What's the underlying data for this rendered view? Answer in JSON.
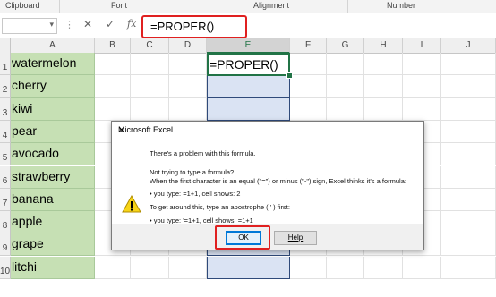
{
  "ribbon": {
    "groups": [
      "Clipboard",
      "Font",
      "Alignment",
      "Number"
    ]
  },
  "formula_bar": {
    "name_box_value": "",
    "cancel_icon": "close-icon",
    "enter_icon": "check-icon",
    "fx_label": "fx",
    "formula": "=PROPER()"
  },
  "columns": [
    "A",
    "B",
    "C",
    "D",
    "E",
    "F",
    "G",
    "H",
    "I",
    "J"
  ],
  "rows": [
    "1",
    "2",
    "3",
    "4",
    "5",
    "6",
    "7",
    "8",
    "9",
    "10"
  ],
  "column_a": [
    "watermelon",
    "cherry",
    "kiwi",
    "pear",
    "avocado",
    "strawberry",
    "banana",
    "apple",
    "grape",
    "litchi"
  ],
  "active_cell": {
    "value": "=PROPER()"
  },
  "dialog": {
    "title": "Microsoft Excel",
    "line1": "There's a problem with this formula.",
    "line2": "Not trying to type a formula?",
    "line3": "When the first character is an equal (\"=\") or minus (\"-\") sign, Excel thinks it's a formula:",
    "line4": "• you type:   =1+1, cell shows:   2",
    "line5": "To get around this, type an apostrophe ( ' ) first:",
    "line6": "• you type:   '=1+1, cell shows:   =1+1",
    "ok_label": "OK",
    "help_label": "Help"
  },
  "colors": {
    "green_fill": "#c6e0b4",
    "blue_fill": "#dae3f3",
    "highlight_red": "#e02020",
    "excel_green": "#217346"
  }
}
